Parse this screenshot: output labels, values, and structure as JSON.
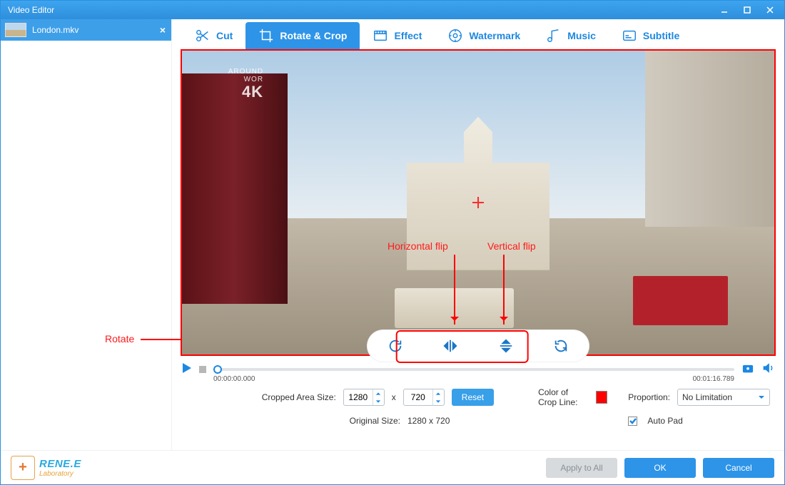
{
  "window": {
    "title": "Video Editor"
  },
  "file": {
    "name": "London.mkv"
  },
  "tabs": {
    "cut": "Cut",
    "rotate": "Rotate & Crop",
    "effect": "Effect",
    "watermark": "Watermark",
    "music": "Music",
    "subtitle": "Subtitle"
  },
  "annotations": {
    "rotate": "Rotate",
    "hflip": "Horizontal flip",
    "vflip": "Vertical flip"
  },
  "watermark": {
    "line1": "AROUND",
    "line2": "WOR",
    "line3": "4K"
  },
  "time": {
    "current": "00:00:00.000",
    "total": "00:01:16.789"
  },
  "crop": {
    "label_size": "Cropped Area Size:",
    "w": "1280",
    "x": "x",
    "h": "720",
    "reset": "Reset",
    "label_orig": "Original Size:",
    "orig": "1280 x 720",
    "label_color": "Color of Crop Line:",
    "label_prop": "Proportion:",
    "prop_value": "No Limitation",
    "autopad": "Auto Pad"
  },
  "footer": {
    "brand1": "RENE.E",
    "brand2": "Laboratory",
    "apply": "Apply to All",
    "ok": "OK",
    "cancel": "Cancel"
  }
}
